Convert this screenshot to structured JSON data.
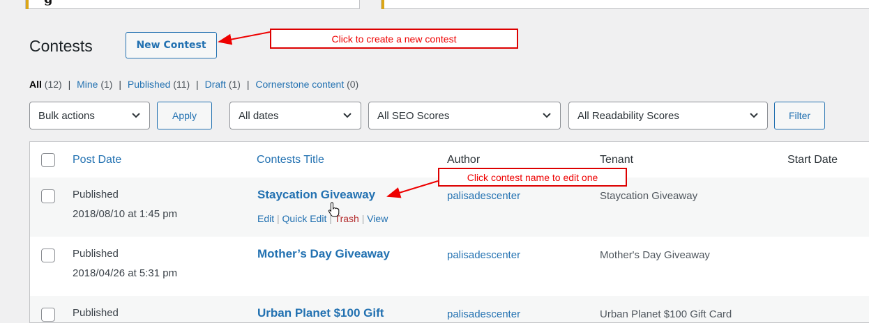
{
  "top_card": {
    "title": "g"
  },
  "page": {
    "title": "Contests",
    "new_button": "New Contest"
  },
  "annotations": {
    "new_contest": "Click to create a new contest",
    "edit_contest": "Click contest name to edit one"
  },
  "filters": {
    "all": {
      "label": "All",
      "count": "(12)"
    },
    "mine": {
      "label": "Mine",
      "count": "(1)"
    },
    "published": {
      "label": "Published",
      "count": "(11)"
    },
    "draft": {
      "label": "Draft",
      "count": "(1)"
    },
    "cornerstone": {
      "label": "Cornerstone content",
      "count": "(0)"
    },
    "separator": "|"
  },
  "toolbar": {
    "bulk_actions": "Bulk actions",
    "apply": "Apply",
    "dates": "All dates",
    "seo": "All SEO Scores",
    "readability": "All Readability Scores",
    "filter": "Filter"
  },
  "table": {
    "headers": {
      "post_date": "Post Date",
      "title": "Contests Title",
      "author": "Author",
      "tenant": "Tenant",
      "start_date": "Start Date"
    },
    "rows": [
      {
        "status": "Published",
        "date": "2018/08/10 at 1:45 pm",
        "title": "Staycation Giveaway",
        "author": "palisadescenter",
        "tenant": "Staycation Giveaway"
      },
      {
        "status": "Published",
        "date": "2018/04/26 at 5:31 pm",
        "title": "Mother’s Day Giveaway",
        "author": "palisadescenter",
        "tenant": "Mother's Day Giveaway"
      },
      {
        "status": "Published",
        "date": "",
        "title": "Urban Planet $100 Gift",
        "author": "palisadescenter",
        "tenant": "Urban Planet $100 Gift Card"
      }
    ],
    "row_actions": {
      "edit": "Edit",
      "quick_edit": "Quick Edit",
      "trash": "Trash",
      "view": "View",
      "separator": "|"
    }
  },
  "colors": {
    "link": "#2271b1",
    "annotation": "#e00000",
    "trash": "#b32d2e",
    "accent": "#dba617"
  }
}
